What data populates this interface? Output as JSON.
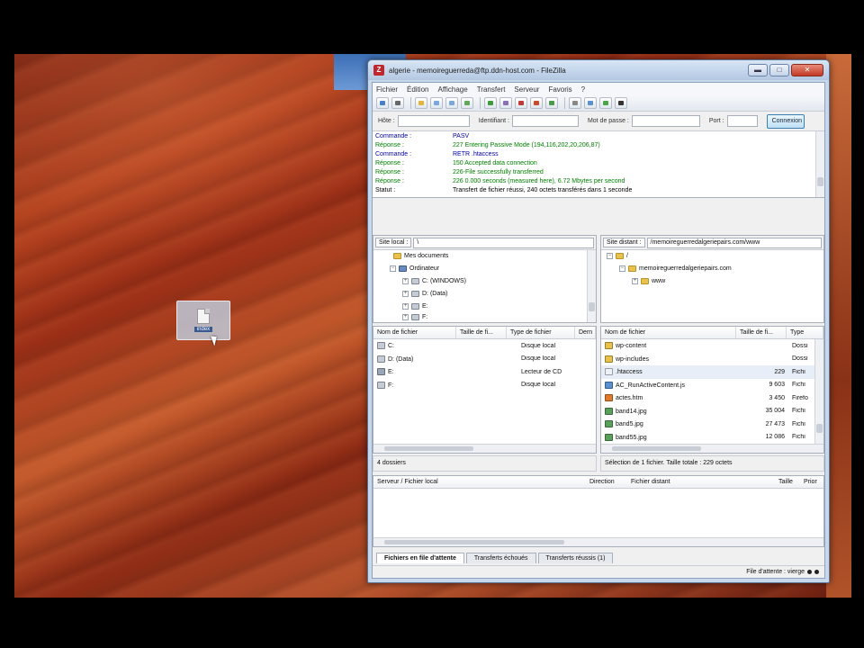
{
  "desktop": {
    "drag_icon_caption": "index"
  },
  "window": {
    "title": "algerie - memoireguerreda@ftp.ddn-host.com - FileZilla",
    "controls": {
      "minimize": "▬",
      "maximize": "□",
      "close": "✕"
    }
  },
  "menu": [
    "Fichier",
    "Édition",
    "Affichage",
    "Transfert",
    "Serveur",
    "Favoris",
    "?"
  ],
  "quickconnect": {
    "host_label": "Hôte :",
    "user_label": "Identifiant :",
    "pass_label": "Mot de passe :",
    "port_label": "Port :",
    "host_value": "",
    "user_value": "",
    "pass_value": "",
    "port_value": "",
    "connect_button": "Connexion rapide"
  },
  "log": [
    {
      "key": "Commande :",
      "msg": "PASV",
      "kind": "cmd"
    },
    {
      "key": "Réponse :",
      "msg": "227 Entering Passive Mode (194,116,202,20,206,87)",
      "kind": "resp"
    },
    {
      "key": "Commande :",
      "msg": "RETR .htaccess",
      "kind": "cmd"
    },
    {
      "key": "Réponse :",
      "msg": "150 Accepted data connection",
      "kind": "resp"
    },
    {
      "key": "Réponse :",
      "msg": "226-File successfully transferred",
      "kind": "resp"
    },
    {
      "key": "Réponse :",
      "msg": "226 0.000 seconds (measured here), 6.72 Mbytes per second",
      "kind": "resp"
    },
    {
      "key": "Statut :",
      "msg": "Transfert de fichier réussi, 240 octets transférés dans 1 seconde",
      "kind": "stat"
    }
  ],
  "local": {
    "site_label": "Site local :",
    "path": "\\",
    "tree": [
      "Mes documents",
      "Ordinateur",
      "C: (WINDOWS)",
      "D: (Data)",
      "E:",
      "F:"
    ],
    "columns": [
      "Nom de fichier",
      "Taille de fi...",
      "Type de fichier",
      "Dern"
    ],
    "files": [
      {
        "name": "C:",
        "size": "",
        "type": "Disque local"
      },
      {
        "name": "D: (Data)",
        "size": "",
        "type": "Disque local"
      },
      {
        "name": "E:",
        "size": "",
        "type": "Lecteur de CD"
      },
      {
        "name": "F:",
        "size": "",
        "type": "Disque local"
      }
    ],
    "status": "4 dossiers"
  },
  "remote": {
    "site_label": "Site distant :",
    "path": "/memoireguerredalgeriepairs.com/www",
    "tree": [
      "/",
      "memoireguerredalgeriepairs.com",
      "www"
    ],
    "columns": [
      "Nom de fichier",
      "Taille de fi...",
      "Type"
    ],
    "files": [
      {
        "name": "wp-content",
        "size": "",
        "type": "Dossi"
      },
      {
        "name": "wp-includes",
        "size": "",
        "type": "Dossi"
      },
      {
        "name": ".htaccess",
        "size": "229",
        "type": "Fichi"
      },
      {
        "name": "AC_RunActiveContent.js",
        "size": "9 603",
        "type": "Fichi"
      },
      {
        "name": "actes.htm",
        "size": "3 450",
        "type": "Firefo"
      },
      {
        "name": "band14.jpg",
        "size": "35 004",
        "type": "Fichi"
      },
      {
        "name": "band5.jpg",
        "size": "27 473",
        "type": "Fichi"
      },
      {
        "name": "band55.jpg",
        "size": "12 086",
        "type": "Fichi"
      }
    ],
    "status": "Sélection de 1 fichier. Taille totale : 229 octets"
  },
  "queue": {
    "columns": [
      "Serveur / Fichier local",
      "Direction",
      "Fichier distant",
      "Taille",
      "Prior"
    ]
  },
  "tabs": [
    "Fichiers en file d'attente",
    "Transferts échoués",
    "Transferts réussis (1)"
  ],
  "bottom_status": "File d'attente : vierge",
  "colors": {
    "accent": "#3c7fb1",
    "command": "#0000aa",
    "response": "#008000"
  }
}
